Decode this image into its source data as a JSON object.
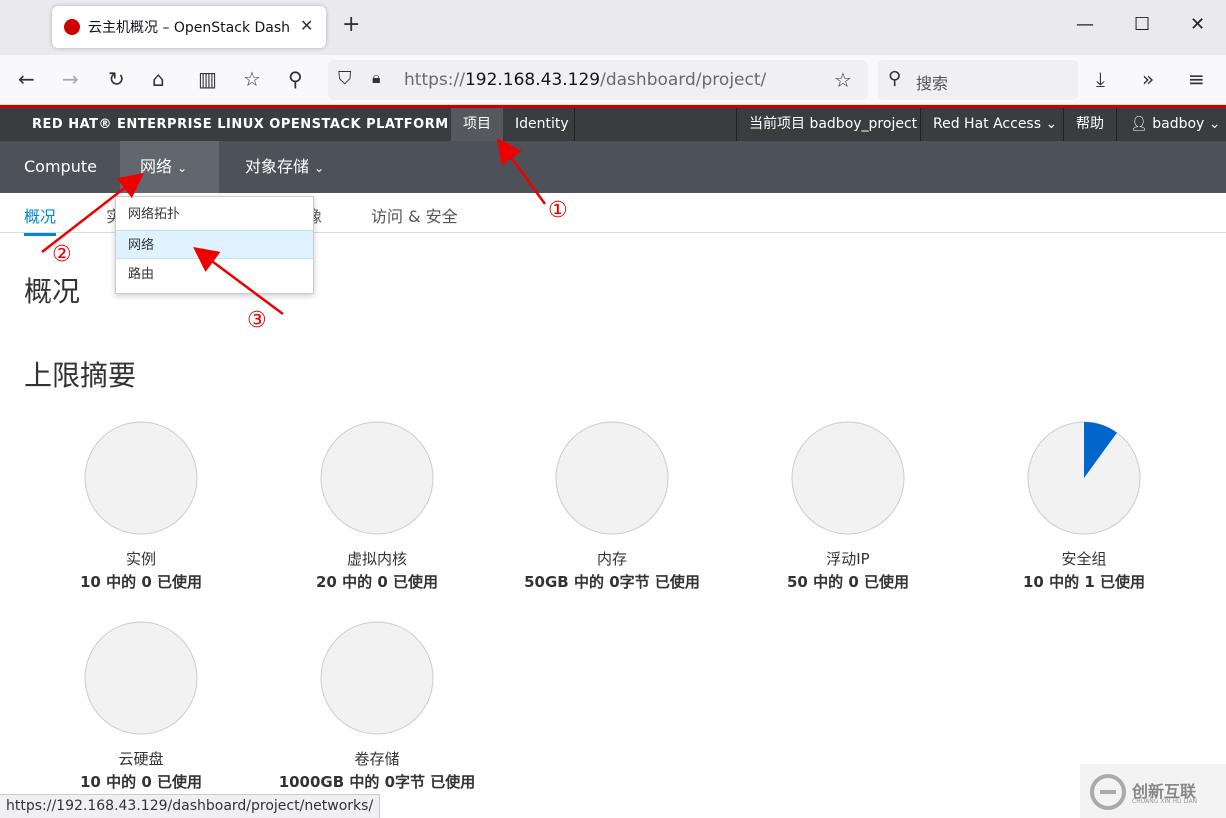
{
  "browser": {
    "tab_title": "云主机概况 – OpenStack Dash",
    "tab_close": "✕",
    "newtab": "+",
    "url_scheme": "https://",
    "url_host": "192.168.43.129",
    "url_path": "/dashboard/project/",
    "search_placeholder": "搜索"
  },
  "osbar": {
    "brand": "RED HAT® ENTERPRISE LINUX OPENSTACK PLATFORM",
    "project_tab": "项目",
    "identity_tab": "Identity",
    "current_project": "当前项目 badboy_project",
    "redhat_access": "Red Hat Access",
    "help": "帮助",
    "user": "badboy"
  },
  "secnav": {
    "compute": "Compute",
    "network": "网络",
    "object_storage": "对象存储"
  },
  "subnav": {
    "overview": "概况",
    "item2": "实",
    "item3": "像",
    "access": "访问 & 安全"
  },
  "dropdown": {
    "items": [
      "网络拓扑",
      "网络",
      "路由"
    ]
  },
  "page": {
    "title": "概况",
    "limits_title": "上限摘要"
  },
  "limits": [
    {
      "label": "实例",
      "usage": "10 中的 0 已使用",
      "fraction": 0
    },
    {
      "label": "虚拟内核",
      "usage": "20 中的 0 已使用",
      "fraction": 0
    },
    {
      "label": "内存",
      "usage": "50GB 中的 0字节 已使用",
      "fraction": 0
    },
    {
      "label": "浮动IP",
      "usage": "50 中的 0 已使用",
      "fraction": 0
    },
    {
      "label": "安全组",
      "usage": "10 中的 1 已使用",
      "fraction": 0.1
    },
    {
      "label": "云硬盘",
      "usage": "10 中的 0 已使用",
      "fraction": 0
    },
    {
      "label": "卷存储",
      "usage": "1000GB 中的 0字节 已使用",
      "fraction": 0
    }
  ],
  "status_url": "https://192.168.43.129/dashboard/project/networks/",
  "watermark": {
    "text": "创新互联",
    "sub": "CHUANG XIN HU LIAN"
  },
  "annotations": [
    "①",
    "②",
    "③"
  ],
  "colors": {
    "brand_red": "#cc0000",
    "pie_fill": "#0066cc",
    "pie_bg": "#f2f2f2",
    "arrow": "#e00000"
  }
}
